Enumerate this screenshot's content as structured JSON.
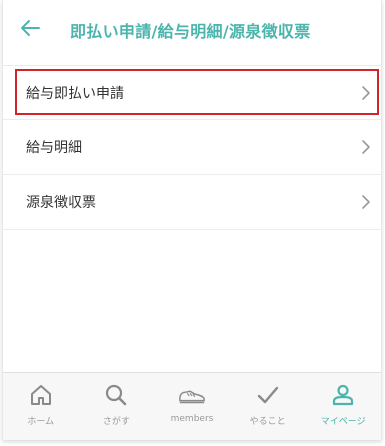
{
  "colors": {
    "accent": "#4bb5ad",
    "highlight": "#d0232a",
    "text": "#333333",
    "muted": "#9a9a9a"
  },
  "header": {
    "back_icon": "arrow-left-icon",
    "title": "即払い申請/給与明細/源泉徴収票"
  },
  "list": {
    "items": [
      {
        "label": "給与即払い申請",
        "icon": "chevron-right-icon"
      },
      {
        "label": "給与明細",
        "icon": "chevron-right-icon"
      },
      {
        "label": "源泉徴収票",
        "icon": "chevron-right-icon"
      }
    ]
  },
  "tabbar": {
    "tabs": [
      {
        "label": "ホーム",
        "icon": "home-icon"
      },
      {
        "label": "さがす",
        "icon": "search-icon"
      },
      {
        "label": "members",
        "icon": "sneaker-icon"
      },
      {
        "label": "やること",
        "icon": "checkmark-icon"
      },
      {
        "label": "マイページ",
        "icon": "user-icon",
        "active": true
      }
    ]
  }
}
